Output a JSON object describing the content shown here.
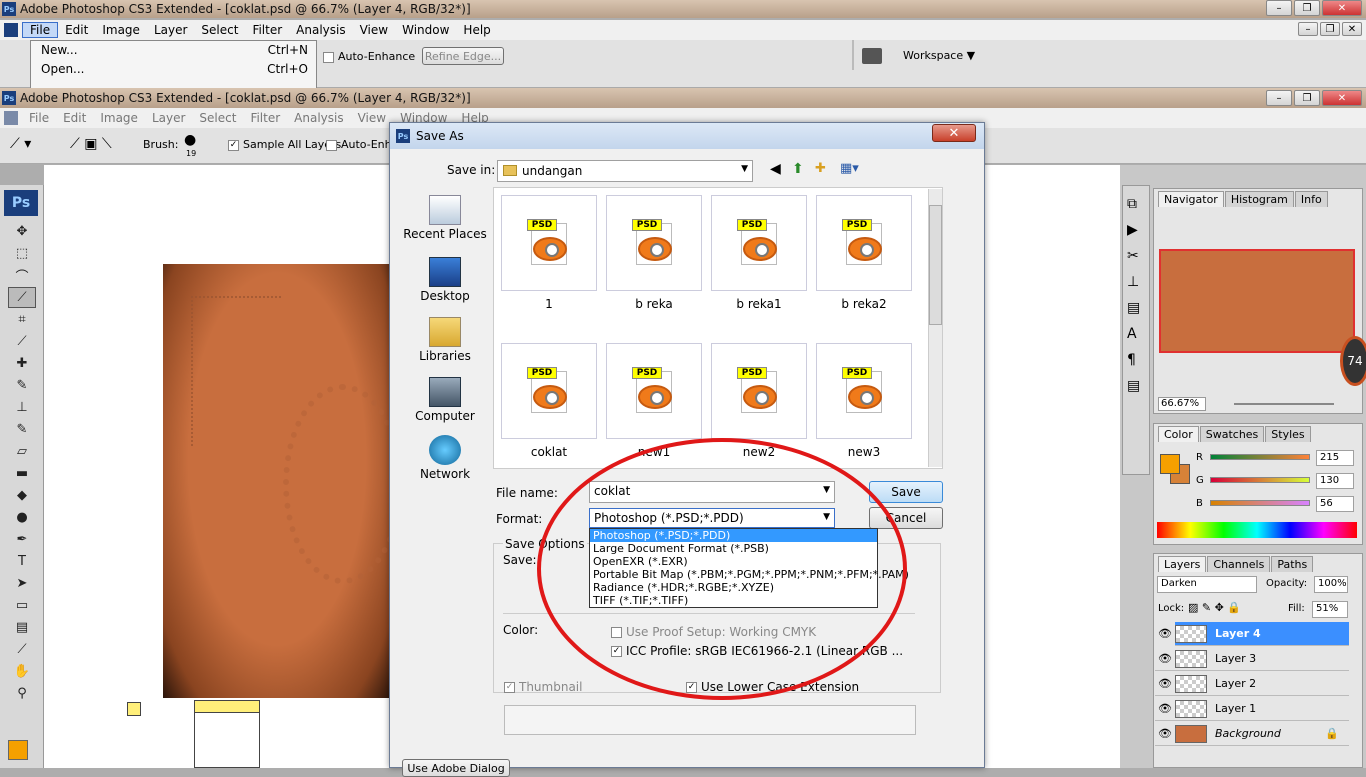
{
  "outer_window": {
    "title": "Adobe Photoshop CS3 Extended - [coklat.psd @ 66.7% (Layer 4, RGB/32*)]",
    "menu": [
      "File",
      "Edit",
      "Image",
      "Layer",
      "Select",
      "Filter",
      "Analysis",
      "View",
      "Window",
      "Help"
    ],
    "auto_enhance": "Auto-Enhance",
    "refine_edge": "Refine Edge...",
    "workspace": "Workspace ▼",
    "file_menu": [
      {
        "label": "New...",
        "shortcut": "Ctrl+N"
      },
      {
        "label": "Open...",
        "shortcut": "Ctrl+O"
      }
    ]
  },
  "inner_window": {
    "title": "Adobe Photoshop CS3 Extended - [coklat.psd @ 66.7% (Layer 4, RGB/32*)]",
    "menu": [
      "File",
      "Edit",
      "Image",
      "Layer",
      "Select",
      "Filter",
      "Analysis",
      "View",
      "Window",
      "Help"
    ],
    "brush_label": "Brush:",
    "brush_size": "19",
    "sample_all_layers": "Sample All Layers",
    "auto_enhance": "Auto-Enha"
  },
  "dialog": {
    "title": "Save As",
    "save_in_label": "Save in:",
    "save_in_value": "undangan",
    "places": [
      "Recent Places",
      "Desktop",
      "Libraries",
      "Computer",
      "Network"
    ],
    "files": [
      "1",
      "b reka",
      "b reka1",
      "b reka2",
      "coklat",
      "new1",
      "new2",
      "new3"
    ],
    "file_badge": "PSD",
    "file_name_label": "File name:",
    "file_name_value": "coklat",
    "format_label": "Format:",
    "format_value": "Photoshop (*.PSD;*.PDD)",
    "save_button": "Save",
    "cancel_button": "Cancel",
    "format_options": [
      "Photoshop (*.PSD;*.PDD)",
      "Large Document Format (*.PSB)",
      "OpenEXR (*.EXR)",
      "Portable Bit Map (*.PBM;*.PGM;*.PPM;*.PNM;*.PFM;*.PAM)",
      "Radiance (*.HDR;*.RGBE;*.XYZE)",
      "TIFF (*.TIF;*.TIFF)"
    ],
    "save_options_label": "Save Options",
    "save_label": "Save:",
    "color_label": "Color:",
    "use_proof_setup": "Use Proof Setup:  Working CMYK",
    "icc_profile": "ICC Profile:  sRGB IEC61966-2.1 (Linear RGB ...",
    "thumbnail": "Thumbnail",
    "lower_case": "Use Lower Case Extension",
    "use_adobe_dialog": "Use Adobe Dialog"
  },
  "navigator": {
    "tabs": [
      "Navigator",
      "Histogram",
      "Info"
    ],
    "zoom": "66.67%"
  },
  "color_panel": {
    "tabs": [
      "Color",
      "Swatches",
      "Styles"
    ],
    "r_label": "R",
    "r": "215",
    "g_label": "G",
    "g": "130",
    "b_label": "B",
    "b": "56",
    "fg": "#d78238"
  },
  "layers_panel": {
    "tabs": [
      "Layers",
      "Channels",
      "Paths"
    ],
    "blend_mode": "Darken",
    "opacity_label": "Opacity:",
    "opacity": "100%",
    "lock_label": "Lock:",
    "fill_label": "Fill:",
    "fill": "51%",
    "layers": [
      "Layer 4",
      "Layer 3",
      "Layer 2",
      "Layer 1",
      "Background"
    ]
  },
  "badge_74": "74",
  "ps_logo": "Ps"
}
